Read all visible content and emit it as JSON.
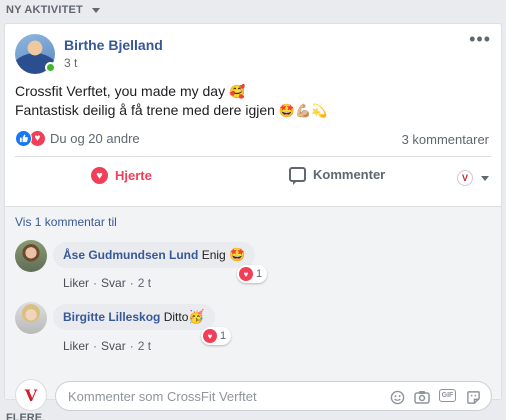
{
  "section": {
    "title": "NY AKTIVITET"
  },
  "post": {
    "author": "Birthe Bjelland",
    "time": "3 t",
    "more": "•••",
    "line1": "Crossfit Verftet, you made my day",
    "line1_emoji": "🥰",
    "line2": "Fantastisk deilig å få trene med dere igjen",
    "line2_emoji": "🤩💪🏼💫",
    "reactions_text": "Du og 20 andre",
    "comments_count": "3 kommentarer"
  },
  "actions": {
    "heart": "Hjerte",
    "comment": "Kommenter",
    "page_logo": "V"
  },
  "comments": {
    "view_more": "Vis 1 kommentar til",
    "items": [
      {
        "name": "Åse Gudmundsen Lund",
        "text": "Enig",
        "emoji": "🤩",
        "reaction_count": "1",
        "like": "Liker",
        "reply": "Svar",
        "sep": "·",
        "time": "2 t"
      },
      {
        "name": "Birgitte Lilleskog",
        "text": "Ditto",
        "emoji": "🥳",
        "reaction_count": "1",
        "like": "Liker",
        "reply": "Svar",
        "sep": "·",
        "time": "2 t"
      }
    ]
  },
  "composer": {
    "placeholder": "Kommenter som CrossFit Verftet",
    "logo": "V",
    "gif_label": "GIF"
  },
  "footer": {
    "title": "FLERE"
  },
  "colors": {
    "link": "#365899",
    "love": "#f33e58",
    "like": "#1877f2",
    "online": "#42b72a"
  }
}
